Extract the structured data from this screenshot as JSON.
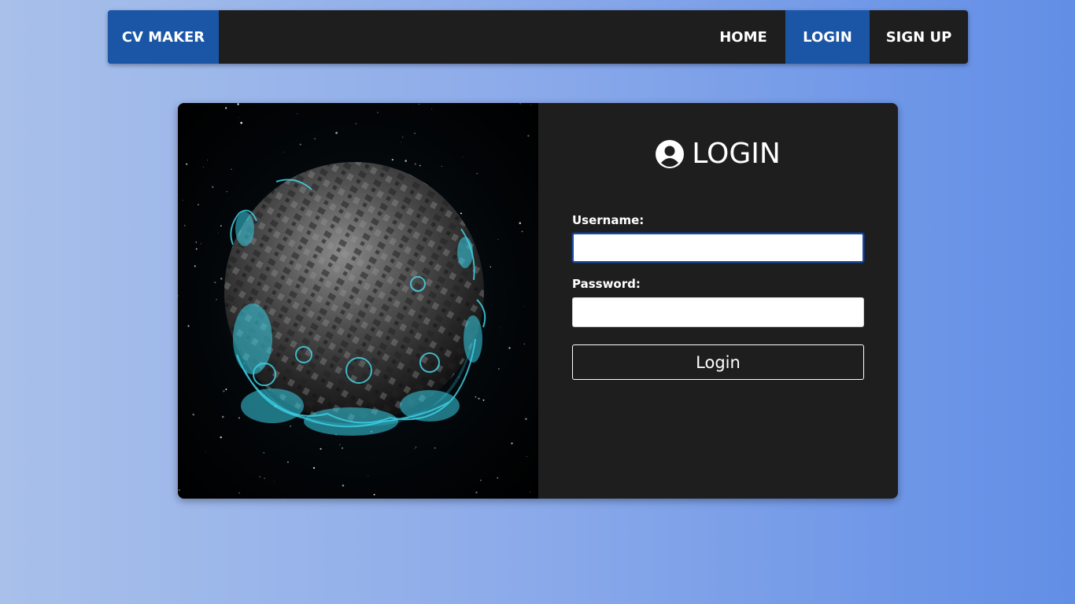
{
  "navbar": {
    "brand": "CV MAKER",
    "items": [
      {
        "label": "HOME"
      },
      {
        "label": "LOGIN",
        "active": true
      },
      {
        "label": "SIGN UP"
      }
    ]
  },
  "login": {
    "title": "LOGIN",
    "icon": "user-circle-icon",
    "username_label": "Username:",
    "username_value": "",
    "password_label": "Password:",
    "password_value": "",
    "button_label": "Login"
  },
  "image": {
    "description_icon": "planet-image"
  },
  "colors": {
    "accent": "#1b56a6",
    "panel": "#1e1e1e",
    "glow": "#39d0e6"
  }
}
